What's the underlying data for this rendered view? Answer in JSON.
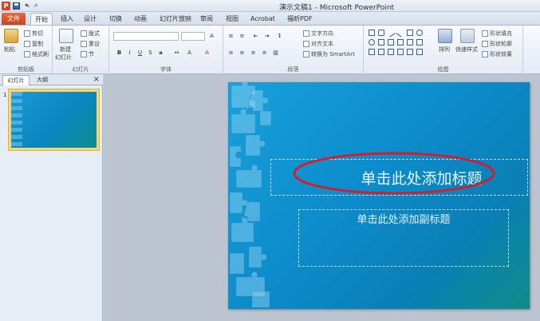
{
  "window": {
    "title": "演示文稿1 - Microsoft PowerPoint",
    "app_logo": "P"
  },
  "tabs": [
    {
      "label": "文件",
      "kind": "file"
    },
    {
      "label": "开始",
      "kind": "active"
    },
    {
      "label": "插入"
    },
    {
      "label": "设计"
    },
    {
      "label": "切换"
    },
    {
      "label": "动画"
    },
    {
      "label": "幻灯片放映"
    },
    {
      "label": "审阅"
    },
    {
      "label": "视图"
    },
    {
      "label": "Acrobat"
    },
    {
      "label": "福昕PDF"
    }
  ],
  "ribbon": {
    "clipboard": {
      "label": "剪贴板",
      "paste": "粘贴",
      "cut": "剪切",
      "copy": "复制",
      "format_painter": "格式刷"
    },
    "slides": {
      "label": "幻灯片",
      "new_slide": "新建",
      "new_slide_2": "幻灯片",
      "layout": "版式",
      "reset": "重设",
      "section": "节"
    },
    "font": {
      "label": "字体"
    },
    "paragraph": {
      "label": "段落",
      "text_direction": "文字方向",
      "align_text": "对齐文本",
      "smartart": "转换为 SmartArt"
    },
    "drawing": {
      "label": "绘图",
      "arrange": "排列",
      "quick_styles": "快速样式",
      "shape_fill": "形状填充",
      "shape_outline": "形状轮廓",
      "shape_effects": "形状效果"
    }
  },
  "left_panel": {
    "tab_slides": "幻灯片",
    "tab_outline": "大纲",
    "close": "×",
    "slide_number": "1"
  },
  "slide": {
    "title_placeholder": "单击此处添加标题",
    "subtitle_placeholder": "单击此处添加副标题"
  },
  "colors": {
    "file_tab": "#c4461f",
    "slide_background": "#0d8ccb",
    "annotation_ellipse": "#d0202c"
  },
  "icons": {
    "app": "powerpoint-logo-icon",
    "save": "save-icon",
    "undo": "undo-icon",
    "redo": "redo-icon",
    "close_panel": "close-icon"
  }
}
